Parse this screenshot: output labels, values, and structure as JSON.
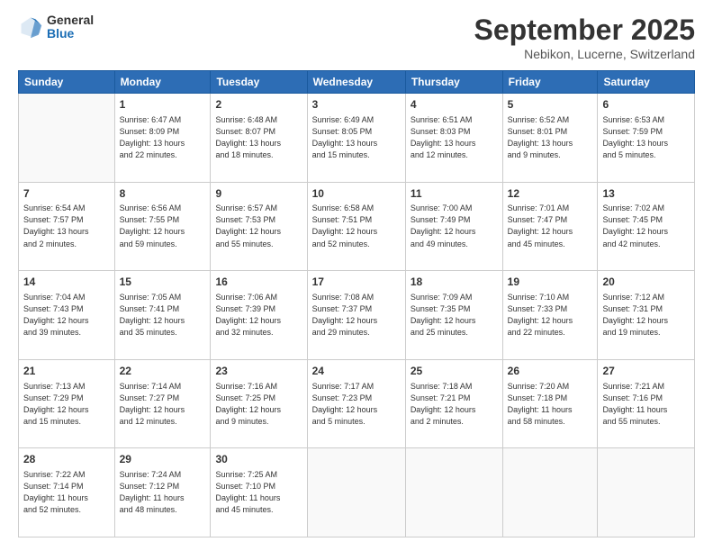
{
  "logo": {
    "general": "General",
    "blue": "Blue"
  },
  "header": {
    "month": "September 2025",
    "location": "Nebikon, Lucerne, Switzerland"
  },
  "weekdays": [
    "Sunday",
    "Monday",
    "Tuesday",
    "Wednesday",
    "Thursday",
    "Friday",
    "Saturday"
  ],
  "weeks": [
    [
      {
        "day": "",
        "info": ""
      },
      {
        "day": "1",
        "info": "Sunrise: 6:47 AM\nSunset: 8:09 PM\nDaylight: 13 hours\nand 22 minutes."
      },
      {
        "day": "2",
        "info": "Sunrise: 6:48 AM\nSunset: 8:07 PM\nDaylight: 13 hours\nand 18 minutes."
      },
      {
        "day": "3",
        "info": "Sunrise: 6:49 AM\nSunset: 8:05 PM\nDaylight: 13 hours\nand 15 minutes."
      },
      {
        "day": "4",
        "info": "Sunrise: 6:51 AM\nSunset: 8:03 PM\nDaylight: 13 hours\nand 12 minutes."
      },
      {
        "day": "5",
        "info": "Sunrise: 6:52 AM\nSunset: 8:01 PM\nDaylight: 13 hours\nand 9 minutes."
      },
      {
        "day": "6",
        "info": "Sunrise: 6:53 AM\nSunset: 7:59 PM\nDaylight: 13 hours\nand 5 minutes."
      }
    ],
    [
      {
        "day": "7",
        "info": "Sunrise: 6:54 AM\nSunset: 7:57 PM\nDaylight: 13 hours\nand 2 minutes."
      },
      {
        "day": "8",
        "info": "Sunrise: 6:56 AM\nSunset: 7:55 PM\nDaylight: 12 hours\nand 59 minutes."
      },
      {
        "day": "9",
        "info": "Sunrise: 6:57 AM\nSunset: 7:53 PM\nDaylight: 12 hours\nand 55 minutes."
      },
      {
        "day": "10",
        "info": "Sunrise: 6:58 AM\nSunset: 7:51 PM\nDaylight: 12 hours\nand 52 minutes."
      },
      {
        "day": "11",
        "info": "Sunrise: 7:00 AM\nSunset: 7:49 PM\nDaylight: 12 hours\nand 49 minutes."
      },
      {
        "day": "12",
        "info": "Sunrise: 7:01 AM\nSunset: 7:47 PM\nDaylight: 12 hours\nand 45 minutes."
      },
      {
        "day": "13",
        "info": "Sunrise: 7:02 AM\nSunset: 7:45 PM\nDaylight: 12 hours\nand 42 minutes."
      }
    ],
    [
      {
        "day": "14",
        "info": "Sunrise: 7:04 AM\nSunset: 7:43 PM\nDaylight: 12 hours\nand 39 minutes."
      },
      {
        "day": "15",
        "info": "Sunrise: 7:05 AM\nSunset: 7:41 PM\nDaylight: 12 hours\nand 35 minutes."
      },
      {
        "day": "16",
        "info": "Sunrise: 7:06 AM\nSunset: 7:39 PM\nDaylight: 12 hours\nand 32 minutes."
      },
      {
        "day": "17",
        "info": "Sunrise: 7:08 AM\nSunset: 7:37 PM\nDaylight: 12 hours\nand 29 minutes."
      },
      {
        "day": "18",
        "info": "Sunrise: 7:09 AM\nSunset: 7:35 PM\nDaylight: 12 hours\nand 25 minutes."
      },
      {
        "day": "19",
        "info": "Sunrise: 7:10 AM\nSunset: 7:33 PM\nDaylight: 12 hours\nand 22 minutes."
      },
      {
        "day": "20",
        "info": "Sunrise: 7:12 AM\nSunset: 7:31 PM\nDaylight: 12 hours\nand 19 minutes."
      }
    ],
    [
      {
        "day": "21",
        "info": "Sunrise: 7:13 AM\nSunset: 7:29 PM\nDaylight: 12 hours\nand 15 minutes."
      },
      {
        "day": "22",
        "info": "Sunrise: 7:14 AM\nSunset: 7:27 PM\nDaylight: 12 hours\nand 12 minutes."
      },
      {
        "day": "23",
        "info": "Sunrise: 7:16 AM\nSunset: 7:25 PM\nDaylight: 12 hours\nand 9 minutes."
      },
      {
        "day": "24",
        "info": "Sunrise: 7:17 AM\nSunset: 7:23 PM\nDaylight: 12 hours\nand 5 minutes."
      },
      {
        "day": "25",
        "info": "Sunrise: 7:18 AM\nSunset: 7:21 PM\nDaylight: 12 hours\nand 2 minutes."
      },
      {
        "day": "26",
        "info": "Sunrise: 7:20 AM\nSunset: 7:18 PM\nDaylight: 11 hours\nand 58 minutes."
      },
      {
        "day": "27",
        "info": "Sunrise: 7:21 AM\nSunset: 7:16 PM\nDaylight: 11 hours\nand 55 minutes."
      }
    ],
    [
      {
        "day": "28",
        "info": "Sunrise: 7:22 AM\nSunset: 7:14 PM\nDaylight: 11 hours\nand 52 minutes."
      },
      {
        "day": "29",
        "info": "Sunrise: 7:24 AM\nSunset: 7:12 PM\nDaylight: 11 hours\nand 48 minutes."
      },
      {
        "day": "30",
        "info": "Sunrise: 7:25 AM\nSunset: 7:10 PM\nDaylight: 11 hours\nand 45 minutes."
      },
      {
        "day": "",
        "info": ""
      },
      {
        "day": "",
        "info": ""
      },
      {
        "day": "",
        "info": ""
      },
      {
        "day": "",
        "info": ""
      }
    ]
  ]
}
